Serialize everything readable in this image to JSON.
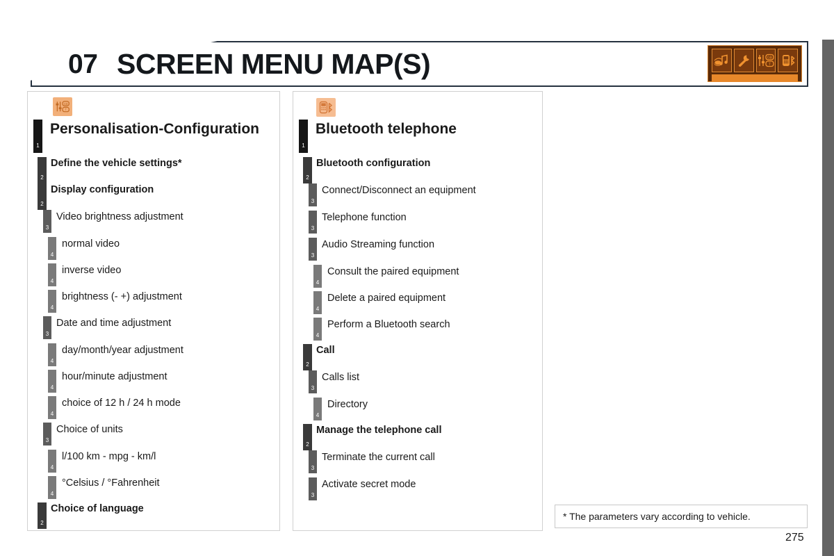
{
  "header": {
    "chapter_number": "07",
    "chapter_title": "SCREEN MENU MAP(S)",
    "icons": [
      {
        "name": "media-audio-icon",
        "label": "media"
      },
      {
        "name": "wrench-settings-icon",
        "label": "settings"
      },
      {
        "name": "configuration-sliders-icon",
        "label": "configuration"
      },
      {
        "name": "bluetooth-phone-icon",
        "label": "telephone"
      }
    ],
    "active_icon_index": 3
  },
  "panels": [
    {
      "icon_name": "configuration-sliders-icon",
      "title": "Personalisation-Configuration",
      "rows": [
        {
          "level": 1,
          "label": "Personalisation-Configuration"
        },
        {
          "level": 2,
          "label": "Define the vehicle settings*"
        },
        {
          "level": 2,
          "label": "Display configuration"
        },
        {
          "level": 3,
          "label": "Video brightness adjustment"
        },
        {
          "level": 4,
          "label": "normal video"
        },
        {
          "level": 4,
          "label": "inverse video"
        },
        {
          "level": 4,
          "label": "brightness (- +) adjustment"
        },
        {
          "level": 3,
          "label": "Date and time adjustment"
        },
        {
          "level": 4,
          "label": "day/month/year adjustment"
        },
        {
          "level": 4,
          "label": "hour/minute adjustment"
        },
        {
          "level": 4,
          "label": "choice of 12 h / 24 h mode"
        },
        {
          "level": 3,
          "label": "Choice of units"
        },
        {
          "level": 4,
          "label": "l/100 km - mpg - km/l"
        },
        {
          "level": 4,
          "label": "°Celsius / °Fahrenheit"
        },
        {
          "level": 2,
          "label": "Choice of language"
        }
      ]
    },
    {
      "icon_name": "bluetooth-phone-icon",
      "title": "Bluetooth telephone",
      "rows": [
        {
          "level": 1,
          "label": "Bluetooth telephone"
        },
        {
          "level": 2,
          "label": "Bluetooth configuration"
        },
        {
          "level": 3,
          "label": "Connect/Disconnect an equipment"
        },
        {
          "level": 3,
          "label": "Telephone function"
        },
        {
          "level": 3,
          "label": "Audio Streaming function"
        },
        {
          "level": 4,
          "label": "Consult the paired equipment"
        },
        {
          "level": 4,
          "label": "Delete a paired equipment"
        },
        {
          "level": 4,
          "label": "Perform a Bluetooth search"
        },
        {
          "level": 2,
          "label": "Call"
        },
        {
          "level": 3,
          "label": "Calls list"
        },
        {
          "level": 4,
          "label": "Directory"
        },
        {
          "level": 2,
          "label": "Manage the telephone call"
        },
        {
          "level": 3,
          "label": "Terminate the current call"
        },
        {
          "level": 3,
          "label": "Activate secret mode"
        }
      ]
    }
  ],
  "footnote": "* The parameters vary according to vehicle.",
  "page_number": "275",
  "colors": {
    "banner_border": "#25313f",
    "icon_strip_background": "#5a2b09",
    "icon_accent": "#e8882a",
    "panel_icon_background": "#f2b07a",
    "level1_bar": "#161616",
    "level2_bar": "#3a3a3a",
    "level3_bar": "#5c5c5c",
    "level4_bar": "#7a7a7a",
    "edge_bar": "#646464"
  }
}
